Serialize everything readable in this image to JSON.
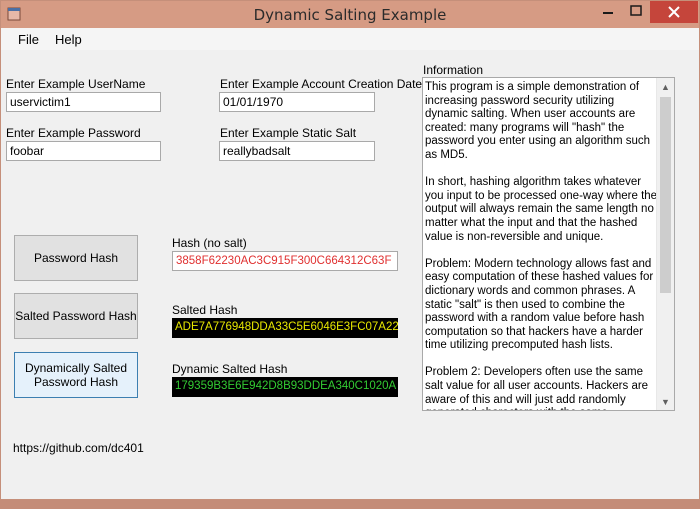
{
  "window": {
    "title": "Dynamic Salting Example",
    "minimize_glyph": "—",
    "maximize_glyph": "☐",
    "close_glyph": "✕"
  },
  "menu": {
    "items": [
      "File",
      "Help"
    ]
  },
  "inputs": {
    "username": {
      "label": "Enter Example UserName",
      "value": "uservictim1"
    },
    "password": {
      "label": "Enter Example Password",
      "value": "foobar"
    },
    "creation_date": {
      "label": "Enter Example Account Creation Date",
      "value": "01/01/1970"
    },
    "static_salt": {
      "label": "Enter Example Static Salt",
      "value": "reallybadsalt"
    }
  },
  "buttons": {
    "password_hash": "Password Hash",
    "salted_password_hash": "Salted Password Hash",
    "dynamic_line1": "Dynamically Salted",
    "dynamic_line2": "Password Hash"
  },
  "outputs": {
    "hash_no_salt": {
      "label": "Hash (no salt)",
      "value": "3858F62230AC3C915F300C664312C63F",
      "color": "#e03030"
    },
    "salted_hash": {
      "label": "Salted Hash",
      "value": "ADE7A776948DDA33C5E6046E3FC07A22",
      "color": "#e8e800",
      "bg": "#000000"
    },
    "dynamic_salted_hash": {
      "label": "Dynamic Salted Hash",
      "value": "179359B3E6E942D8B93DDEA340C1020A",
      "color": "#33cc33",
      "bg": "#000000"
    }
  },
  "information": {
    "label": "Information",
    "text": "This program is a simple demonstration of increasing password security utilizing dynamic salting. When user accounts are created: many programs will \"hash\" the password you enter using an algorithm such as MD5.\n\nIn short, hashing algorithm takes whatever you input to be processed one-way where the output will always remain the same length no matter what the input and that the hashed value is non-reversible and unique.\n\nProblem: Modern technology allows fast and easy computation of these hashed values for dictionary words and common phrases. A static \"salt\" is then used to combine the password with a random value before hash computation so that hackers have a harder time utilizing precomputed hash lists.\n\nProblem 2: Developers often use the same salt value for all user accounts. Hackers are aware of this and will just add randomly generated characters with the same dictionary words and phrases to bypass this.",
    "scroll_up_glyph": "▲",
    "scroll_down_glyph": "▼"
  },
  "footer": {
    "link": "https://github.com/dc401"
  }
}
